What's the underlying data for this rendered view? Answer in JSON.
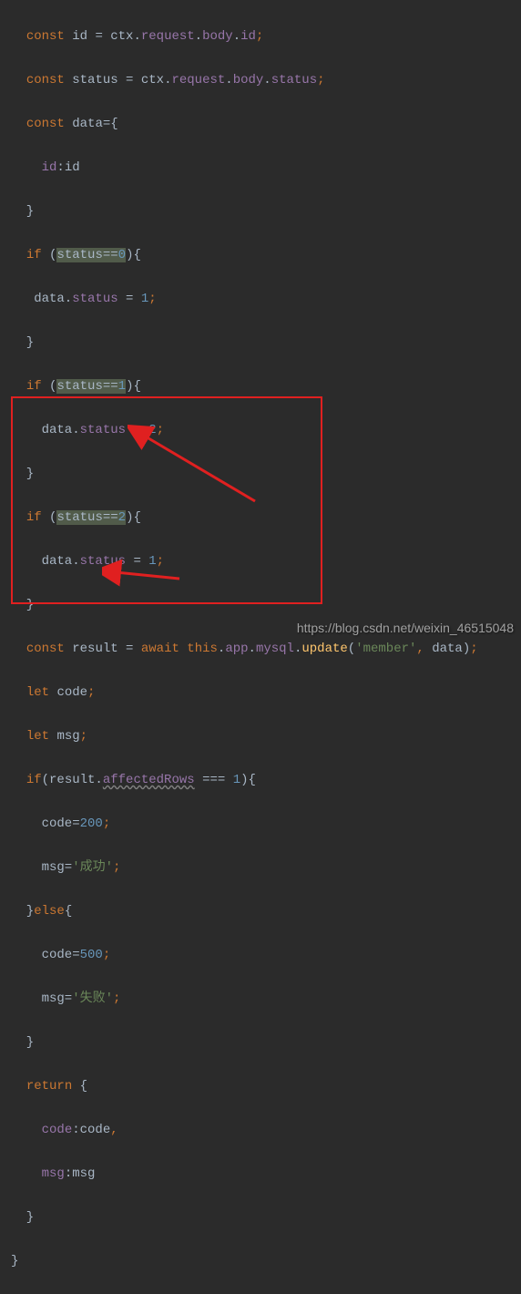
{
  "code": {
    "l1_const": "const",
    "l1_id": "id",
    "l1_eq": " = ctx.",
    "l1_req": "request",
    "l1_body": "body",
    "l1_idp": "id",
    "l2_status": "status",
    "l2_statusp": "status",
    "l3_data": "data",
    "l4_id": "id",
    "l5_lbrace": "}",
    "l6_if": "if",
    "l6_stat": "status==",
    "l6_zero": "0",
    "l7_data": "data.",
    "l7_stat": "status",
    "l7_eq": " = ",
    "l7_one": "1",
    "l9_one": "1",
    "l10_two": "2",
    "l12_two": "2",
    "l13_one": "1",
    "l15_result": "result",
    "l15_await": "await",
    "l15_this": "this",
    "l15_app": "app",
    "l15_mysql": "mysql",
    "l15_update": "update",
    "l15_member": "'member'",
    "l16_let": "let",
    "l16_code": "code",
    "l17_msg": "msg",
    "l18_affrows": "affectedRows",
    "l18_triple": " === ",
    "l18_one": "1",
    "l19_200": "200",
    "l20_success": "'成功'",
    "l21_else": "else",
    "l22_500": "500",
    "l23_fail": "'失败'",
    "l25_return": "return",
    "l26_code": "code",
    "l27_msg": "msg"
  },
  "watermark": "https://blog.csdn.net/weixin_46515048",
  "chart_data": null
}
